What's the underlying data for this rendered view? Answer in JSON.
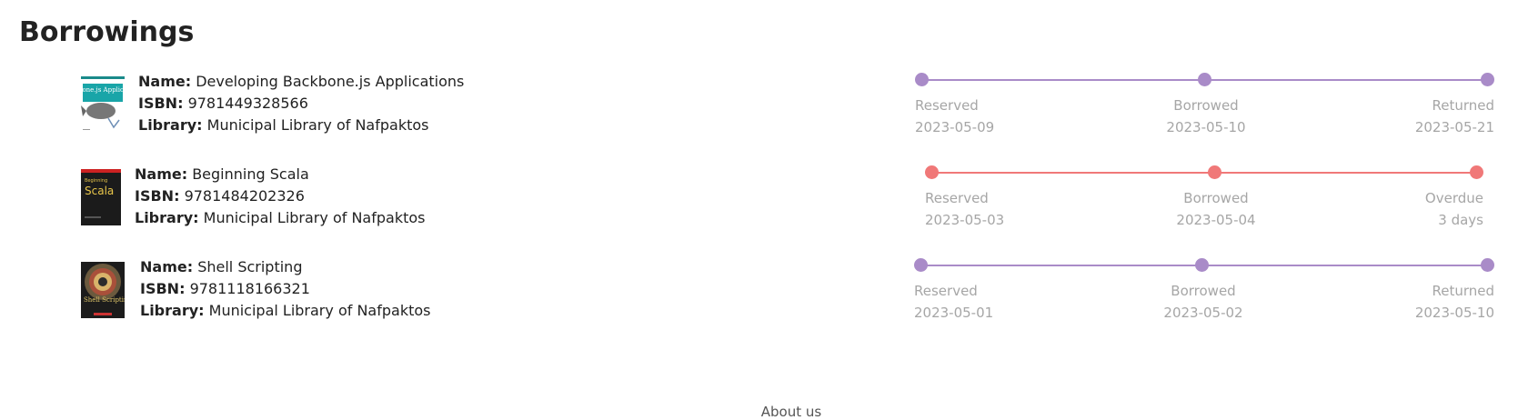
{
  "page": {
    "title": "Borrowings"
  },
  "labels": {
    "name": "Name:",
    "isbn": "ISBN:",
    "library": "Library:"
  },
  "colors": {
    "returned": "#a98bc8",
    "overdue": "#f07878"
  },
  "borrowings": [
    {
      "name": "Developing Backbone.js Applications",
      "isbn": "9781449328566",
      "library": "Municipal Library of Nafpaktos",
      "status": "returned",
      "steps": [
        {
          "label": "Reserved",
          "value": "2023-05-09"
        },
        {
          "label": "Borrowed",
          "value": "2023-05-10"
        },
        {
          "label": "Returned",
          "value": "2023-05-21"
        }
      ]
    },
    {
      "name": "Beginning Scala",
      "isbn": "9781484202326",
      "library": "Municipal Library of Nafpaktos",
      "status": "overdue",
      "steps": [
        {
          "label": "Reserved",
          "value": "2023-05-03"
        },
        {
          "label": "Borrowed",
          "value": "2023-05-04"
        },
        {
          "label": "Overdue",
          "value": "3 days"
        }
      ]
    },
    {
      "name": "Shell Scripting",
      "isbn": "9781118166321",
      "library": "Municipal Library of Nafpaktos",
      "status": "returned",
      "steps": [
        {
          "label": "Reserved",
          "value": "2023-05-01"
        },
        {
          "label": "Borrowed",
          "value": "2023-05-02"
        },
        {
          "label": "Returned",
          "value": "2023-05-10"
        }
      ]
    }
  ],
  "covers": [
    {
      "title_text": "Backbone.js Applications"
    },
    {
      "title_text": "Scala"
    },
    {
      "title_text": "Shell Scripting"
    }
  ],
  "footer": {
    "about": "About us"
  }
}
